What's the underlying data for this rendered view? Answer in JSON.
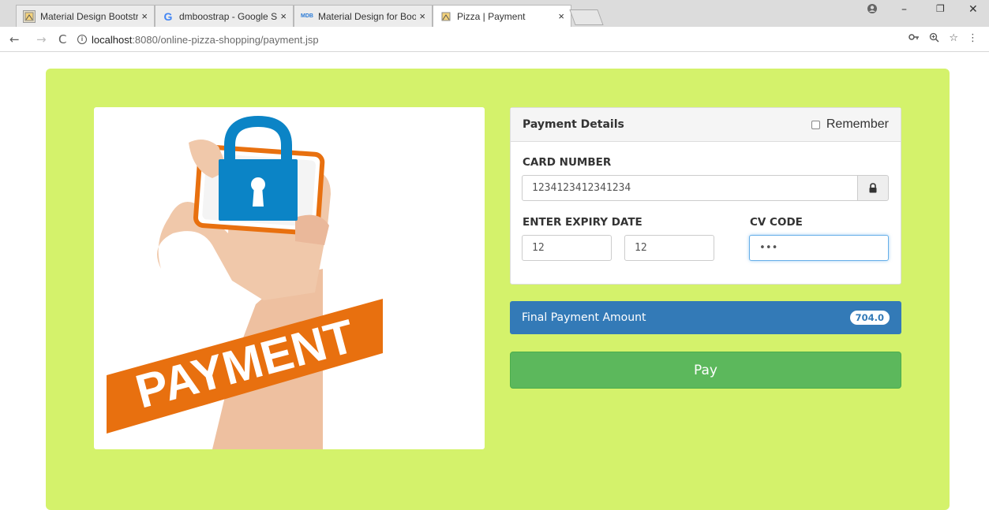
{
  "browser": {
    "tabs": [
      {
        "title": "Material Design Bootstra",
        "favicon": "mdb-logo-icon"
      },
      {
        "title": "dmboostrap - Google Se",
        "favicon": "google-icon"
      },
      {
        "title": "Material Design for Boot",
        "favicon": "mdb-logo-icon"
      },
      {
        "title": "Pizza | Payment",
        "favicon": "pizza-icon"
      }
    ],
    "close_glyph": "×",
    "url_host": "localhost",
    "url_path": ":8080/online-pizza-shopping/payment.jsp"
  },
  "payment": {
    "title": "Payment Details",
    "remember_label": "Remember",
    "card_number_label": "CARD NUMBER",
    "card_number_value": "1234123412341234",
    "expiry_label": "ENTER EXPIRY DATE",
    "expiry_month": "12",
    "expiry_year": "12",
    "cv_label": "CV CODE",
    "cv_value": "•••"
  },
  "amount": {
    "label": "Final Payment Amount",
    "value": "704.0"
  },
  "pay_button": "Pay",
  "image": {
    "text": "PAYMENT"
  },
  "colors": {
    "page_bg": "#d4f26b",
    "primary": "#337ab7",
    "success": "#5cb85c",
    "lock_blue": "#0b84c6",
    "banner_orange": "#e8700f"
  }
}
